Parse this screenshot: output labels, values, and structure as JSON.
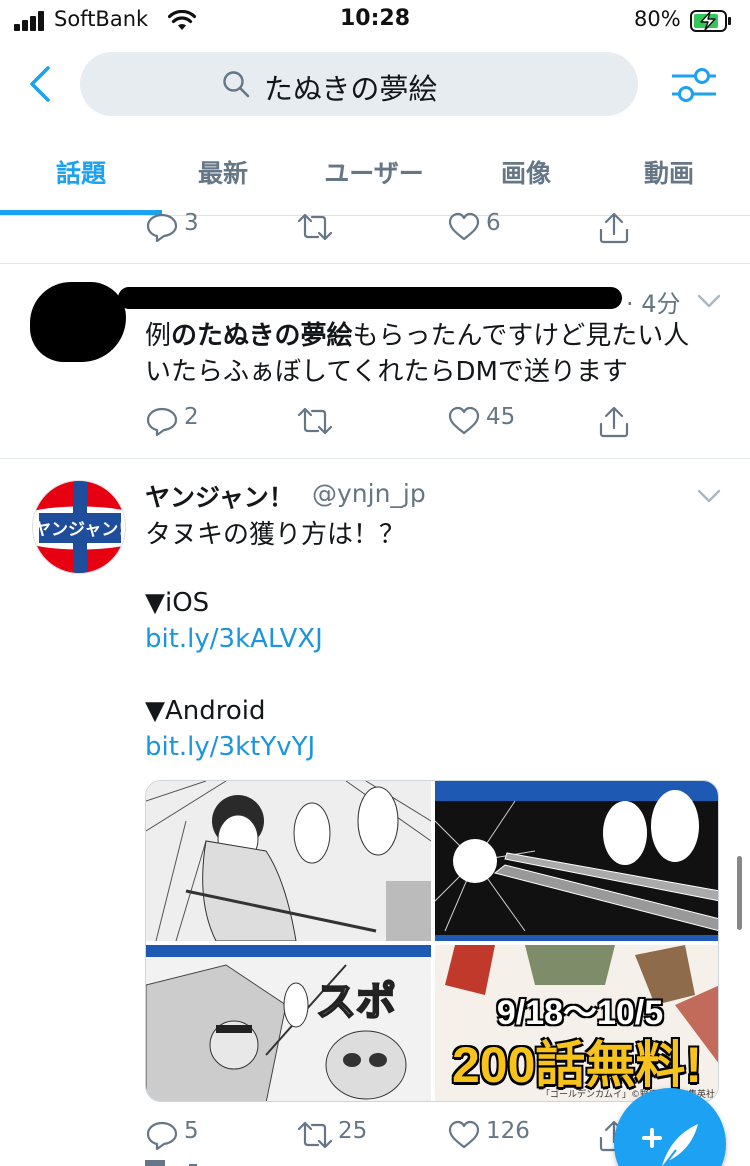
{
  "status_bar": {
    "carrier": "SoftBank",
    "time": "10:28",
    "battery": "80%"
  },
  "search": {
    "query": "たぬきの夢絵"
  },
  "tabs": [
    {
      "label": "話題",
      "active": true
    },
    {
      "label": "最新",
      "active": false
    },
    {
      "label": "ユーザー",
      "active": false
    },
    {
      "label": "画像",
      "active": false
    },
    {
      "label": "動画",
      "active": false
    }
  ],
  "colors": {
    "accent": "#1da1f2",
    "muted": "#657786",
    "link": "#1b95e0"
  },
  "tweets": [
    {
      "actions": {
        "reply": "3",
        "retweet": "",
        "like": "6"
      }
    },
    {
      "time": "4分",
      "text_prefix": "例",
      "text_bold": "のたぬきの夢絵",
      "text_line1_rest": "もらったんですけど見たい人",
      "text_line2": "いたらふぁぼしてくれたらDMで送ります",
      "actions": {
        "reply": "2",
        "retweet": "",
        "like": "45"
      }
    },
    {
      "name": "ヤンジャン！",
      "handle": "@ynjn_jp",
      "line1": "タヌキの獲り方は！？",
      "ios_label": "▼iOS",
      "ios_link": "bit.ly/3kALVXJ",
      "android_label": "▼Android",
      "android_link": "bit.ly/3ktYvYJ",
      "avatar_text": "ヤンジャン!",
      "media": {
        "promo_dates": "9/18〜10/5",
        "promo_text": "200話無料!",
        "promo_credit": "「ゴールデンカムイ」©野田サトル/集英社"
      },
      "actions": {
        "reply": "5",
        "retweet": "25",
        "like": "126"
      }
    }
  ]
}
